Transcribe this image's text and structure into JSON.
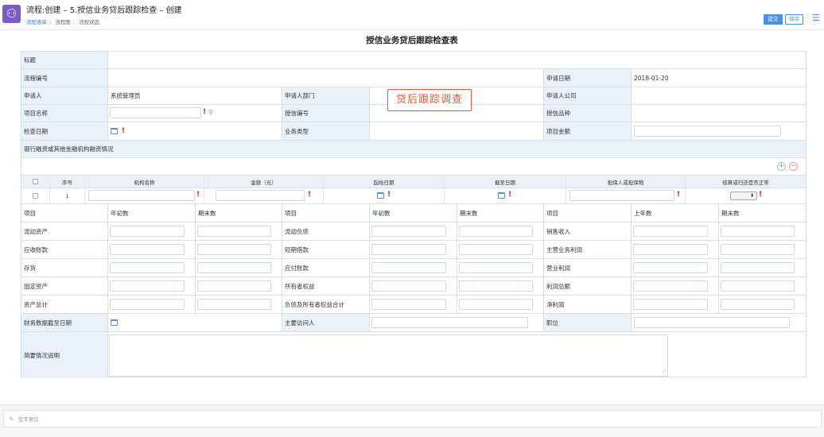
{
  "header": {
    "title": "流程:创建 – 5.授信业务贷后跟踪检查 – 创建",
    "tabs": [
      "流程表单",
      "流程图",
      "流程状态"
    ],
    "submit": "提交",
    "save": "保存"
  },
  "form": {
    "title": "授信业务贷后跟踪检查表",
    "labels": {
      "subject": "标题",
      "flow_no": "流程编号",
      "apply_date": "申请日期",
      "applicant": "申请人",
      "dept": "申请人部门",
      "company": "申请人公司",
      "project_name": "项目名称",
      "credit_no": "授信编号",
      "credit_type": "授信品种",
      "check_date": "检查日期",
      "biz_type": "业务类型",
      "project_amount": "项目金额",
      "bank_section": "银行融资或其他金融机构融资情况"
    },
    "values": {
      "apply_date": "2018-01-20",
      "applicant": "系统管理员"
    },
    "annotation": "贷后跟踪调查",
    "sub_table": {
      "headers": [
        "序号",
        "机构名称",
        "金额（元）",
        "起始日期",
        "截至日期",
        "担保人或担保物",
        "结算或归还是否正常"
      ],
      "rows": [
        {
          "no": "1"
        }
      ]
    },
    "fin_headers": [
      "项目",
      "年初数",
      "期末数",
      "项目",
      "年初数",
      "期末数",
      "项目",
      "上年数",
      "期末数"
    ],
    "fin_rows": [
      [
        "流动资产",
        "流动负债",
        "销售收入"
      ],
      [
        "应收账款",
        "短期借款",
        "主营业务利润"
      ],
      [
        "存货",
        "应付账款",
        "营业利润"
      ],
      [
        "固定资产",
        "所有者权益",
        "利润总额"
      ],
      [
        "资产总计",
        "负债及所有者权益合计",
        "净利润"
      ]
    ],
    "fin_date": "财务数据截至日期",
    "visitor": "主要访问人",
    "position": "职位",
    "summary": "简要情况说明"
  },
  "footer": {
    "sign_placeholder": "签字意见"
  }
}
